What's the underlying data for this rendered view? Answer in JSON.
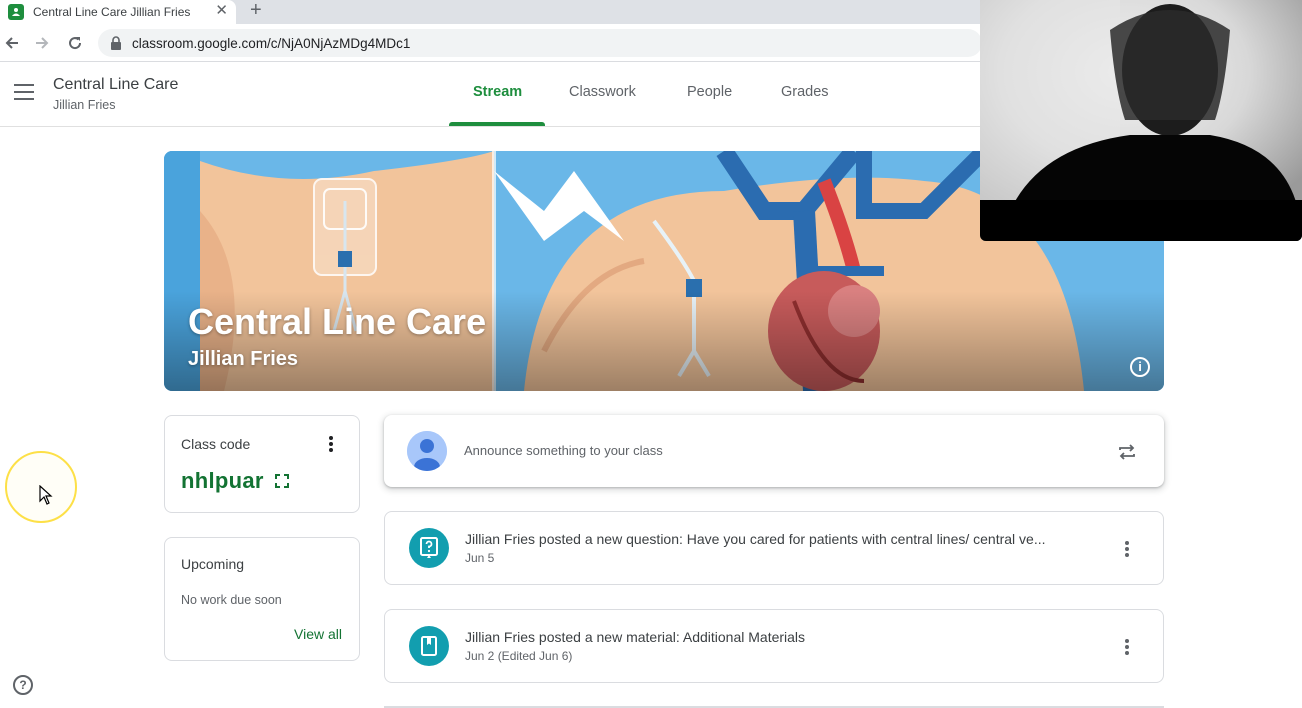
{
  "browser": {
    "tab_title": "Central Line Care Jillian Fries",
    "tab_close": "✕",
    "new_tab": "+",
    "url": "classroom.google.com/c/NjA0NjAzMDg4MDc1"
  },
  "header": {
    "class_name": "Central Line Care",
    "teacher": "Jillian Fries",
    "tabs": [
      {
        "label": "Stream",
        "active": true
      },
      {
        "label": "Classwork",
        "active": false
      },
      {
        "label": "People",
        "active": false
      },
      {
        "label": "Grades",
        "active": false
      }
    ]
  },
  "banner": {
    "title": "Central Line Care",
    "subtitle": "Jillian Fries",
    "info_icon": "i"
  },
  "class_code": {
    "label": "Class code",
    "value": "nhlpuar"
  },
  "upcoming": {
    "title": "Upcoming",
    "empty_text": "No work due soon",
    "view_all": "View all"
  },
  "announce": {
    "placeholder": "Announce something to your class"
  },
  "posts": [
    {
      "title": "Jillian Fries posted a new question: Have you cared for patients with central lines/ central ve...",
      "date": "Jun 5",
      "icon": "question-icon"
    },
    {
      "title": "Jillian Fries posted a new material: Additional Materials",
      "date": "Jun 2 (Edited Jun 6)",
      "icon": "material-icon"
    }
  ],
  "help_icon": "?",
  "colors": {
    "accent_green": "#1e8e3e",
    "class_code_green": "#137333",
    "post_icon_teal": "#129eaf",
    "banner_sky": "#6ab7e8"
  }
}
